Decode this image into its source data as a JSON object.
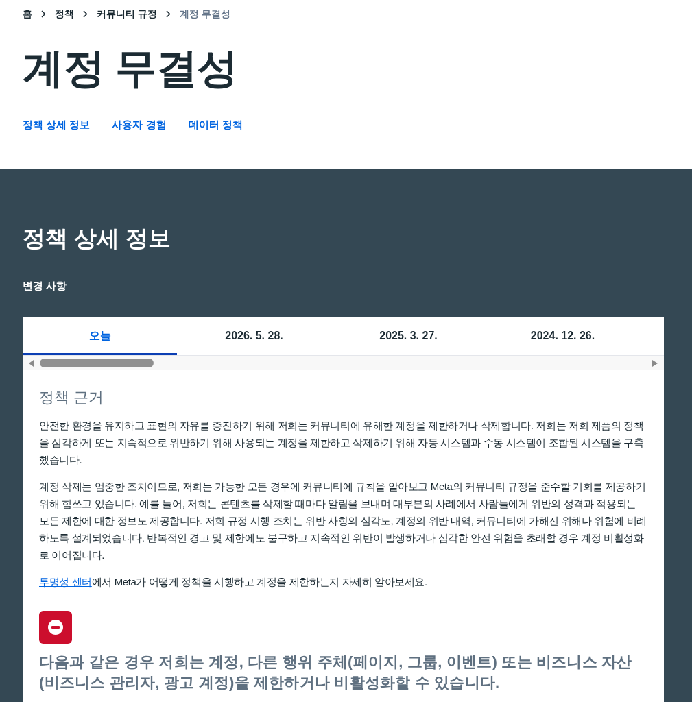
{
  "breadcrumb": [
    {
      "label": "홈",
      "current": false
    },
    {
      "label": "정책",
      "current": false
    },
    {
      "label": "커뮤니티 규정",
      "current": false
    },
    {
      "label": "계정 무결성",
      "current": true
    }
  ],
  "title": "계정 무결성",
  "page_nav": [
    {
      "label": "정책 상세 정보"
    },
    {
      "label": "사용자 경험"
    },
    {
      "label": "데이터 정책"
    }
  ],
  "section": {
    "heading": "정책 상세 정보",
    "changes_label": "변경 사항",
    "tabs": [
      {
        "label": "오늘",
        "selected": true
      },
      {
        "label": "2026. 5. 28.",
        "selected": false
      },
      {
        "label": "2025. 3. 27.",
        "selected": false
      },
      {
        "label": "2024. 12. 26.",
        "selected": false
      }
    ],
    "content": {
      "heading": "정책 근거",
      "paragraphs": [
        "안전한 환경을 유지하고 표현의 자유를 증진하기 위해 저희는 커뮤니티에 유해한 계정을 제한하거나 삭제합니다. 저희는 저희 제품의 정책을 심각하게 또는 지속적으로 위반하기 위해 사용되는 계정을 제한하고 삭제하기 위해 자동 시스템과 수동 시스템이 조합된 시스템을 구축했습니다.",
        "계정 삭제는 엄중한 조치이므로, 저희는 가능한 모든 경우에 커뮤니티에 규칙을 알아보고 Meta의 커뮤니티 규정을 준수할 기회를 제공하기 위해 힘쓰고 있습니다. 예를 들어, 저희는 콘텐츠를 삭제할 때마다 알림을 보내며 대부분의 사례에서 사람들에게 위반의 성격과 적용되는 모든 제한에 대한 정보도 제공합니다. 저희 규정 시행 조치는 위반 사항의 심각도, 계정의 위반 내역, 커뮤니티에 가해진 위해나 위험에 비례하도록 설계되었습니다. 반복적인 경고 및 제한에도 불구하고 지속적인 위반이 발생하거나 심각한 안전 위험을 초래할 경우 계정 비활성화로 이어집니다."
      ],
      "link_note": {
        "link": "투명성 센터",
        "text": "에서 Meta가 어떻게 정책을 시행하고 계정을 제한하는지 자세히 알아보세요."
      },
      "notice": {
        "heading": "다음과 같은 경우 저희는 계정, 다른 행위 주체(페이지, 그룹, 이벤트) 또는 비즈니스 자산(비즈니스 관리자, 광고 계정)을 제한하거나 비활성화할 수 있습니다."
      }
    }
  }
}
